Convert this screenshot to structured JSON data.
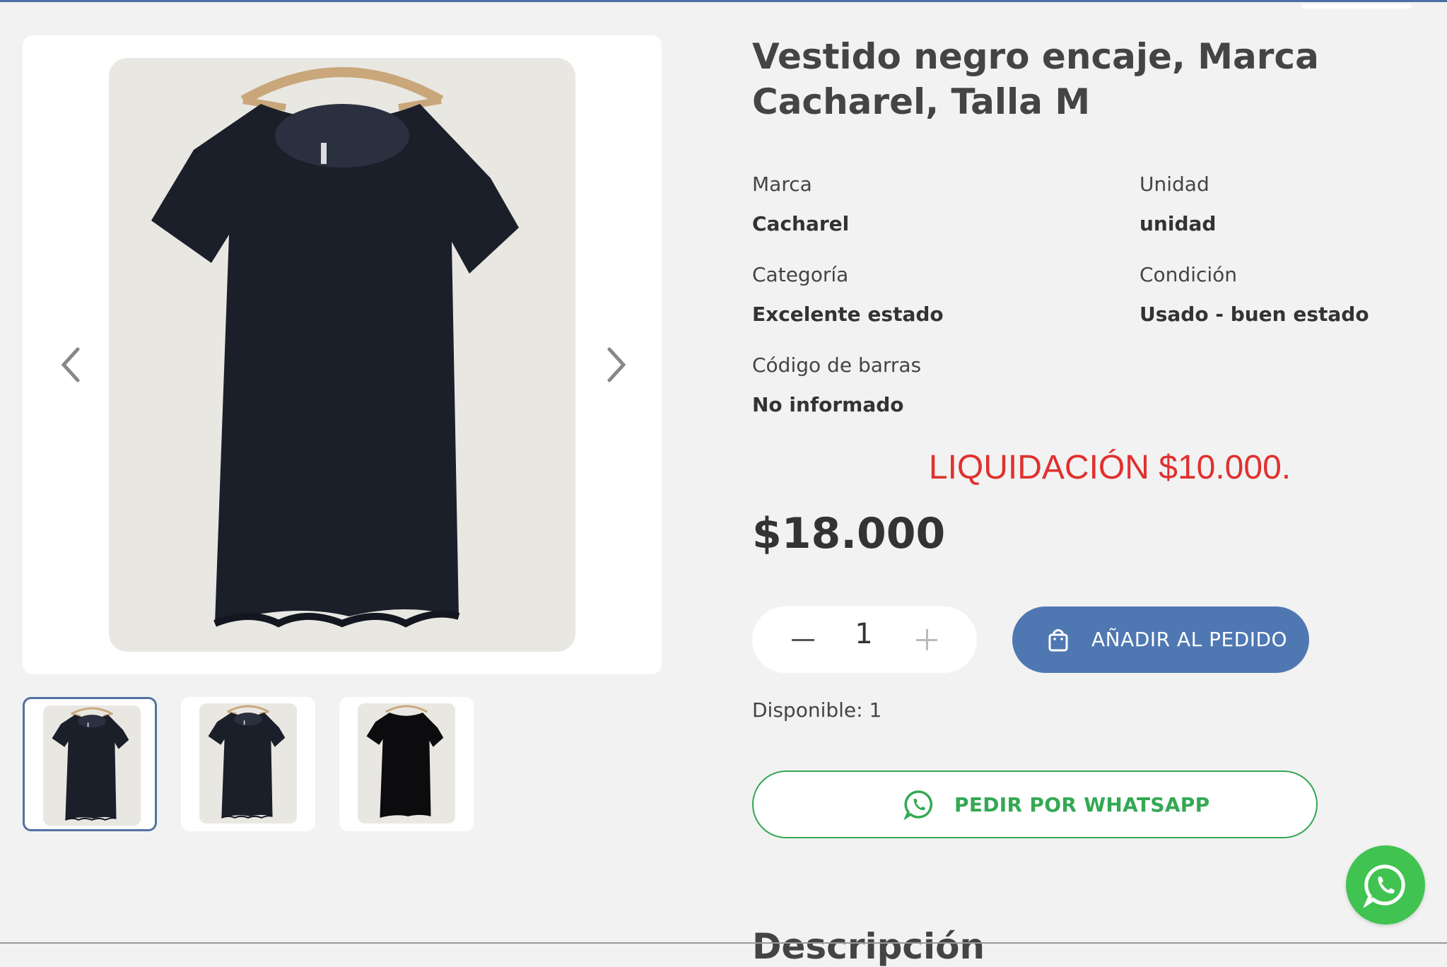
{
  "product": {
    "title": "Vestido negro encaje, Marca Cacharel, Talla M",
    "specs": [
      {
        "label": "Marca",
        "value": "Cacharel"
      },
      {
        "label": "Unidad",
        "value": "unidad"
      },
      {
        "label": "Categoría",
        "value": "Excelente estado"
      },
      {
        "label": "Condición",
        "value": "Usado - buen estado"
      },
      {
        "label": "Código de barras",
        "value": "No informado"
      }
    ],
    "promo": "LIQUIDACIÓN $10.000.",
    "price": "$18.000",
    "quantity": "1",
    "add_to_order": "AÑADIR AL PEDIDO",
    "available": "Disponible: 1",
    "whatsapp_order": "PEDIR POR WHATSAPP"
  },
  "gallery": {
    "icons": {
      "prev": "chevron-left-icon",
      "next": "chevron-right-icon"
    },
    "thumbnails": [
      "dress-front-1",
      "dress-front-2",
      "dress-front-3"
    ],
    "active_thumbnail": 0
  },
  "colors": {
    "accent": "#4f78b3",
    "promo": "#e0312f",
    "whatsapp": "#34a853",
    "whatsapp_float": "#40c351"
  },
  "description_heading": "Descripción"
}
